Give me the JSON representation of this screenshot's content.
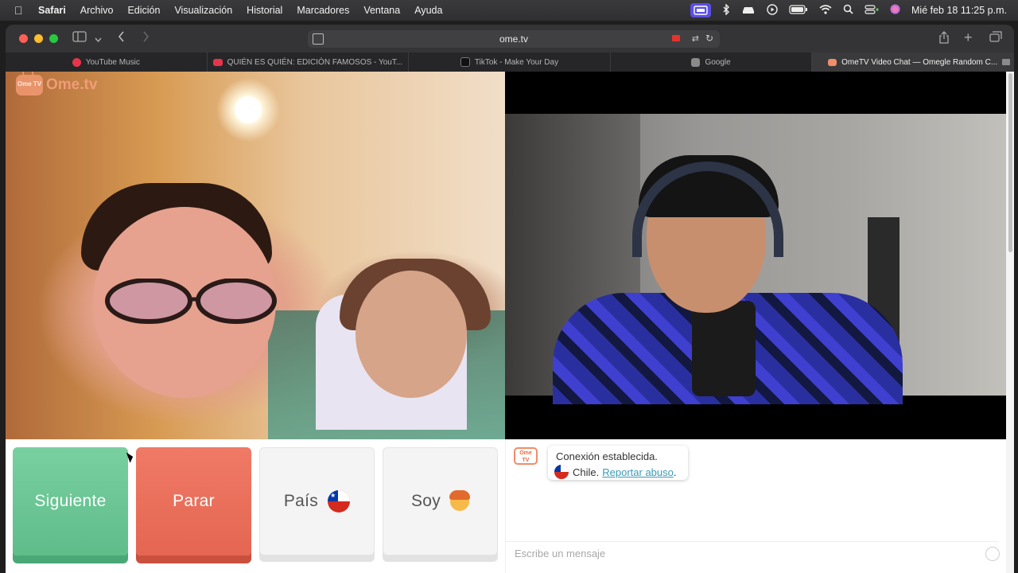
{
  "menubar": {
    "app": "Safari",
    "items": [
      "Archivo",
      "Edición",
      "Visualización",
      "Historial",
      "Marcadores",
      "Ventana",
      "Ayuda"
    ],
    "datetime": "Mié feb 18  11:25 p.m."
  },
  "browser": {
    "url": "ome.tv",
    "tabs": [
      {
        "label": "YouTube Music",
        "favicon_color": "#e8344a"
      },
      {
        "label": "QUIÉN ES QUIÉN: EDICIÓN FAMOSOS - YouT...",
        "favicon_color": "#e8344a"
      },
      {
        "label": "TikTok - Make Your Day",
        "favicon_color": "#111111"
      },
      {
        "label": "Google",
        "favicon_color": "#9a9a9a"
      },
      {
        "label": "OmeTV Video Chat — Omegle Random C...",
        "favicon_color": "#f08d6a"
      }
    ],
    "active_tab_index": 4
  },
  "page": {
    "logo": {
      "badge": "Ome TV",
      "text": "Ome.tv"
    },
    "controls": {
      "next_label": "Siguiente",
      "stop_label": "Parar",
      "country_label": "País",
      "gender_label": "Soy"
    },
    "chat": {
      "icon_label": "Ome TV",
      "connected_text": "Conexión establecida.",
      "country_text": "Chile.",
      "report_link": "Reportar abuso",
      "report_suffix": ".",
      "input_placeholder": "Escribe un mensaje"
    }
  },
  "colors": {
    "next": "#5fbd8a",
    "stop": "#e56652",
    "link": "#3b9bb5",
    "brand": "#f08d6a"
  }
}
